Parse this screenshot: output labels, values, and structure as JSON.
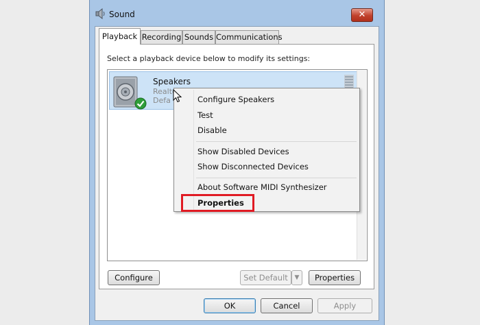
{
  "window": {
    "title": "Sound",
    "close_glyph": "✕",
    "tabs": [
      {
        "label": "Playback",
        "active": true
      },
      {
        "label": "Recording",
        "active": false
      },
      {
        "label": "Sounds",
        "active": false
      },
      {
        "label": "Communications",
        "active": false
      }
    ]
  },
  "playback": {
    "instruction": "Select a playback device below to modify its settings:",
    "device": {
      "name": "Speakers",
      "description": "Realtek High Definition Audio",
      "status": "Defa",
      "icon": "speaker-icon",
      "status_icon": "checkmark-icon"
    },
    "buttons": {
      "configure": "Configure",
      "set_default": "Set Default",
      "properties": "Properties"
    }
  },
  "context_menu": {
    "items": [
      {
        "label": "Configure Speakers"
      },
      {
        "label": "Test"
      },
      {
        "label": "Disable"
      },
      {
        "label": "Show Disabled Devices"
      },
      {
        "label": "Show Disconnected Devices"
      },
      {
        "label": "About Software MIDI Synthesizer"
      },
      {
        "label": "Properties",
        "highlighted": true
      }
    ]
  },
  "footer": {
    "ok": "OK",
    "cancel": "Cancel",
    "apply": "Apply"
  },
  "colors": {
    "accent_highlight": "#e01a23",
    "selection": "#cde3f7",
    "window_frame": "#a9c6e6"
  }
}
